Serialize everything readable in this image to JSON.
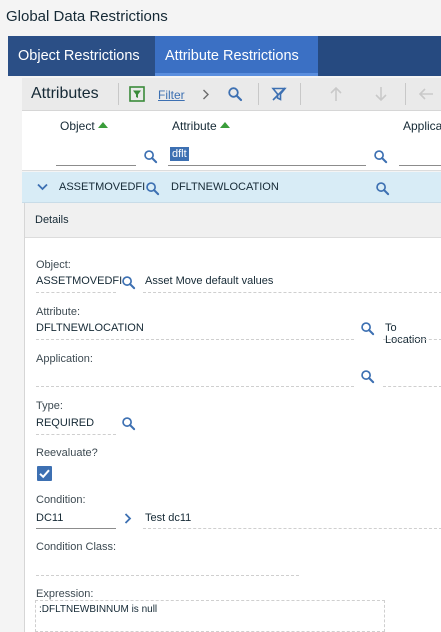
{
  "page": {
    "title": "Global Data Restrictions"
  },
  "tabs": [
    {
      "label": "Object Restrictions"
    },
    {
      "label": "Attribute Restrictions"
    }
  ],
  "toolbar": {
    "title": "Attributes",
    "filter_label": "Filter"
  },
  "table": {
    "columns": [
      "Object",
      "Attribute",
      "Applica"
    ],
    "filter_attribute": "dflt",
    "row": {
      "object": "ASSETMOVEDFI",
      "attribute": "DFLTNEWLOCATION"
    }
  },
  "details": {
    "header": "Details",
    "object": {
      "label": "Object:",
      "value": "ASSETMOVEDFI",
      "description": "Asset Move default values"
    },
    "attribute": {
      "label": "Attribute:",
      "value": "DFLTNEWLOCATION",
      "description": "To Location"
    },
    "application": {
      "label": "Application:",
      "value": ""
    },
    "type": {
      "label": "Type:",
      "value": "REQUIRED"
    },
    "reevaluate": {
      "label": "Reevaluate?",
      "checked": true
    },
    "condition": {
      "label": "Condition:",
      "value": "DC11",
      "description": "Test dc11"
    },
    "condition_class": {
      "label": "Condition Class:",
      "value": ""
    },
    "expression": {
      "label": "Expression:",
      "value": ":DFLTNEWBINNUM is null"
    }
  },
  "colors": {
    "accent": "#3d70b2",
    "tab_bar": "#264a80",
    "tab_active": "#3b70c4",
    "row_selected": "#d8ecf6",
    "sort": "#3a9d3a"
  }
}
